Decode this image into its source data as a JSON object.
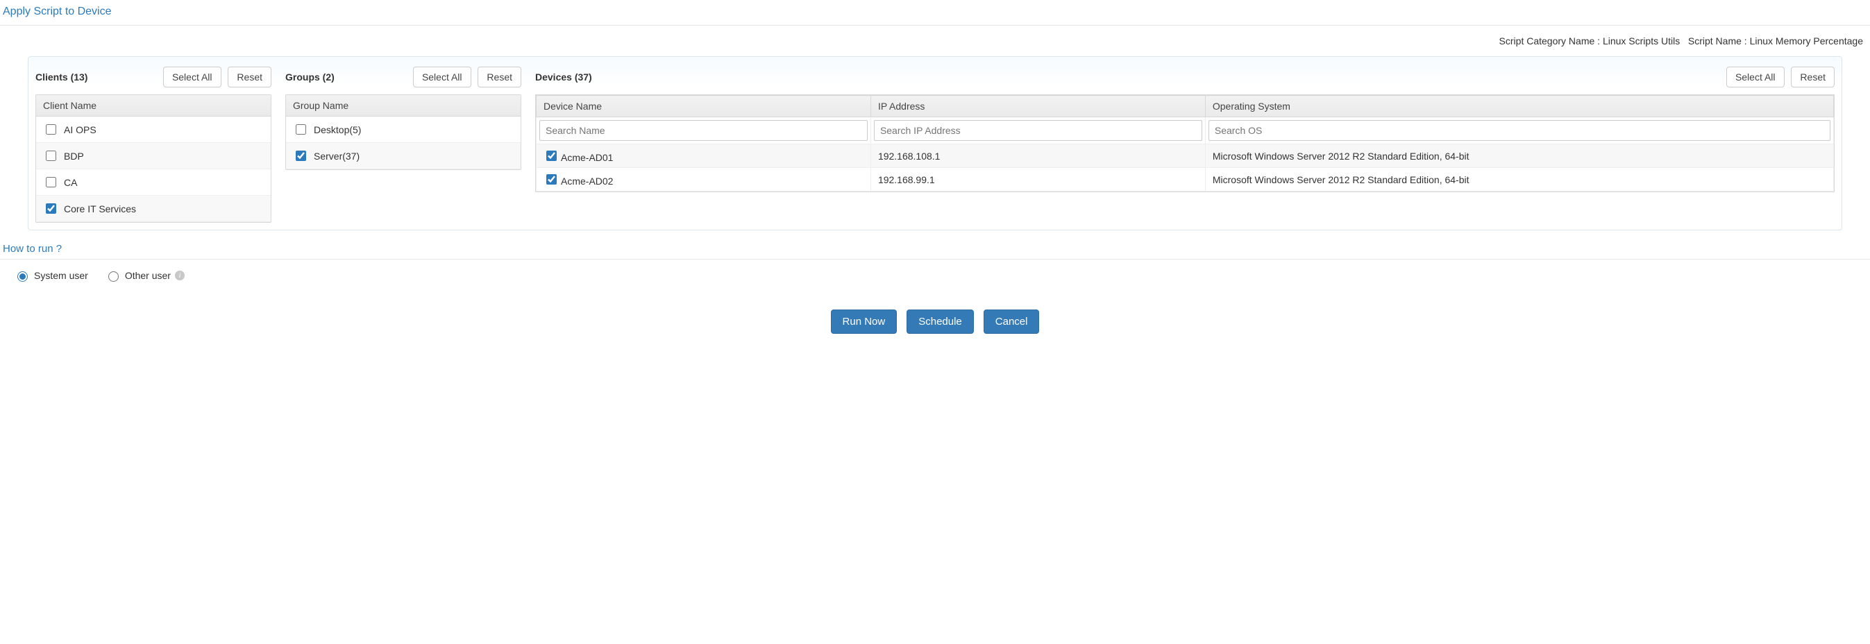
{
  "page_title": "Apply Script to Device",
  "header": {
    "category_label": "Script Category Name :",
    "category_value": "Linux Scripts Utils",
    "script_label": "Script Name :",
    "script_value": "Linux Memory Percentage"
  },
  "clients": {
    "title": "Clients (13)",
    "select_all": "Select All",
    "reset": "Reset",
    "column": "Client Name",
    "rows": [
      {
        "label": "AI OPS",
        "checked": false
      },
      {
        "label": "BDP",
        "checked": false
      },
      {
        "label": "CA",
        "checked": false
      },
      {
        "label": "Core IT Services",
        "checked": true
      }
    ]
  },
  "groups": {
    "title": "Groups (2)",
    "select_all": "Select All",
    "reset": "Reset",
    "column": "Group Name",
    "rows": [
      {
        "label": "Desktop(5)",
        "checked": false
      },
      {
        "label": "Server(37)",
        "checked": true
      }
    ]
  },
  "devices": {
    "title": "Devices (37)",
    "select_all": "Select All",
    "reset": "Reset",
    "columns": {
      "name": "Device Name",
      "ip": "IP Address",
      "os": "Operating System"
    },
    "search": {
      "name_ph": "Search Name",
      "ip_ph": "Search IP Address",
      "os_ph": "Search OS"
    },
    "rows": [
      {
        "checked": true,
        "name": "Acme-AD01",
        "ip": "192.168.108.1",
        "os": "Microsoft Windows Server 2012 R2 Standard Edition, 64-bit"
      },
      {
        "checked": true,
        "name": "Acme-AD02",
        "ip": "192.168.99.1",
        "os": "Microsoft Windows Server 2012 R2 Standard Edition, 64-bit"
      }
    ]
  },
  "howto": "How to run ?",
  "run_as": {
    "system": "System user",
    "other": "Other user"
  },
  "buttons": {
    "run_now": "Run Now",
    "schedule": "Schedule",
    "cancel": "Cancel"
  }
}
